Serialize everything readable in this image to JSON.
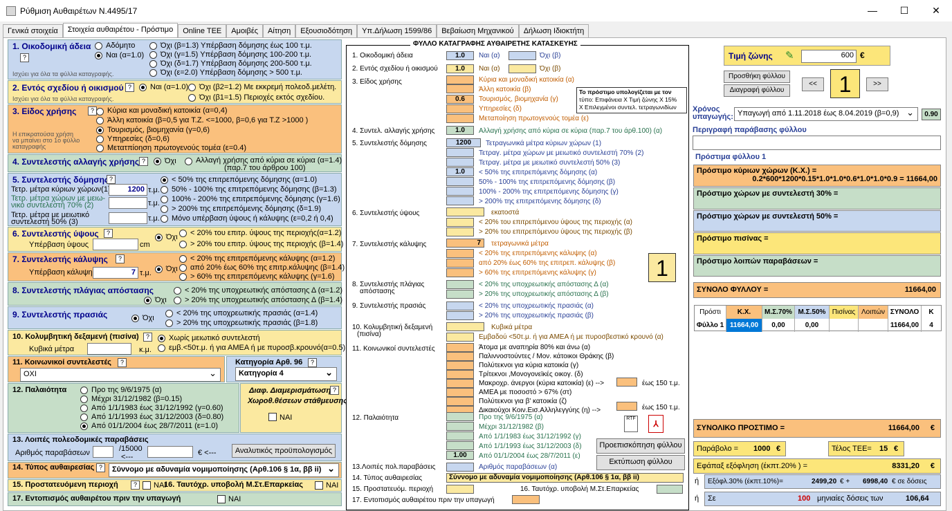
{
  "window": {
    "title": "Ρύθμιση Αυθαιρέτων Ν.4495/17",
    "min": "—",
    "max": "☐",
    "close": "✕"
  },
  "tabs": [
    "Γενικά στοιχεία",
    "Στοιχεία αυθαιρέτου - Πρόστιμο",
    "Online TEE",
    "Αμοιβές",
    "Αίτηση",
    "Εξουσιοδότηση",
    "Υπ.Δήλωση 1599/86",
    "Βεβαίωση Μηχανικού",
    "Δήλωση Ιδιοκτήτη"
  ],
  "left": {
    "s1": {
      "title": "1. Οικοδομική άδεια",
      "o": [
        "Αδόμητο",
        "Ναι (α=1.0)",
        "Όχι (β=1.3) Υπέρβαση δόμησης έως 100 τ.μ.",
        "Όχι (γ=1.5) Υπέρβαση δόμησης 100-200 τ.μ.",
        "Όχι (δ=1.7) Υπέρβαση δόμησης 200-500 τ.μ.",
        "Όχι (ε=2.0) Υπέρβαση δόμησης > 500 τ.μ."
      ],
      "note": "Ισχύει για όλα τα φύλλα καταγραφής."
    },
    "s2": {
      "title": "2. Εντός σχεδίου ή οικισμού",
      "o": [
        "Ναι (α=1.0)",
        "Όχι (β2=1.2) Με εκκρεμή πολεοδ.μελέτη.",
        "Όχι (β1=1.5) Περιοχές εκτός σχεδίου."
      ],
      "note": "Ισχύει για όλα τα φύλλα καταγραφής."
    },
    "s3": {
      "title": "3. Είδος χρήσης",
      "o": [
        "Κύρια και μοναδική κατοικία (α=0,4)",
        "Άλλη κατοικία (β=0,5 για Τ.Ζ. <=1000, β=0,6 για Τ.Ζ >1000 )",
        "Τουρισμός, βιομηχανία (γ=0,6)",
        "Υπηρεσίες (δ=0,6)",
        "Μετατπίοηση πρωτογενούς τομέα (ε=0.4)"
      ],
      "note": "Η επικρατούσα χρήση να μπαίνει στο 1ο φύλλο καταγραφής"
    },
    "s4": {
      "title": "4. Συντελεστής αλλαγής χρήσης",
      "o": [
        "Όχι",
        "Αλλαγή χρήσης από κύρια σε κύρια (α=1.4)",
        "(παρ.7 του άρθρου 100)"
      ]
    },
    "s5": {
      "title": "5. Συντελεστής δόμησης",
      "l1": "Τετρ. μέτρα κύριων χώρων(1)",
      "v1": "1200",
      "l2": "Τετρ. μέτρα χώρων με μειω-",
      "l2b": "νικό συντελεστή 70% (2)",
      "l3": "Τετρ. μέτρα με μειωτικό",
      "l3b": "συντελεστή 50% (3)",
      "u": "τ.μ.",
      "o": [
        "< 50% της επιτρεπόμενης δόμησης (α=1.0)",
        "50% - 100% της επιτρεπόμενης δόμησης (β=1.3)",
        "100% - 200% της επιτρεπόμενης δόμησης (γ=1.6)",
        "> 200% της επιτρεπόμενης δόμησης (δ=1.9)",
        "Μόνο υπέρβαση ύψους ή κάλυψης (ε=0,2 ή 0,4)"
      ]
    },
    "s6": {
      "title": "6. Συντελεστής ύψους",
      "l": "Υπέρβαση ύψους",
      "u": "cm",
      "o": [
        "Όχι",
        "< 20% του επιτρ. ύψους της περιοχής(α=1.2)",
        "> 20% του επιτρ. ύψους της περιοχής (β=1.4)"
      ]
    },
    "s7": {
      "title": "7. Συντελεστής κάλυψης",
      "l": "Υπέρβαση κάλυψης",
      "v": "7",
      "u": "τ.μ.",
      "o": [
        "Όχι",
        "< 20% της επιτρεπόμενης κάλυψης (α=1.2)",
        "από 20% έως 60% της επιτρ.κάλυψης (β=1.4)",
        "> 60% της επιτρεπόμενης κάλυψης (γ=1.6)"
      ]
    },
    "s8": {
      "title": "8. Συντελεστής πλάγιας απόστασης",
      "o": [
        "Όχι",
        "< 20% της υποχρεωτικής απόστασης Δ (α=1.2)",
        "> 20% της υποχρεωτικής απόστασης Δ (β=1.4)"
      ]
    },
    "s9": {
      "title": "9. Συντελεστής πρασιάς",
      "o": [
        "Όχι",
        "< 20% της υποχρεωτικής πρασιάς (α=1.4)",
        "> 20% της υποχρεωτικής πρασιάς (β=1.8)"
      ]
    },
    "s10": {
      "title": "10. Κολυμβητική δεξαμενή (πισίνα)",
      "l": "Κυβικά μέτρα",
      "u": "κ.μ.",
      "o": [
        "Χωρίς μειωτικό συντελεστή",
        "εμβ.<50τ.μ. ή για ΑΜΕΑ ή με πυροσβ.κρουνό(α=0.5)"
      ]
    },
    "s11": {
      "title": "11. Κοινωνικοί συντελεστές",
      "val": "ΟΧΙ",
      "cat": "Κατηγορία Αρθ. 96",
      "catval": "Κατηγορία 4"
    },
    "s12": {
      "title": "12. Παλαιότητα",
      "o": [
        "Προ της 9/6/1975 (α)",
        "Μέχρι 31/12/1982 (β=0.15)",
        "Από 1/1/1983 έως 31/12/1992 (γ=0.60)",
        "Από 1/1/1993 έως 31/12/2003 (δ=0.80)",
        "Από 01/1/2004 έως 28/7/2011 (ε=1.0)"
      ],
      "d1": "Διαφ. Διαμερισμάτωση /",
      "d2": "Χωροθ.θέσεων στάθμευσης",
      "nai": "ΝΑΙ"
    },
    "s13": {
      "title": "13. Λοιπές πολεοδομικές παραβάσεις",
      "l": "Αριθμός παραβάσεων",
      "fr": "/15000",
      "ar": "<---",
      "eu": "€ <---",
      "btn": "Αναλυτικός προϋπολογισμός"
    },
    "s14": {
      "title": "14. Τύπος αυθαιρεσίας",
      "val": "Σύννομο με αδυναμία νομιμοποίησης (Αρθ.106 § 1α, ββ ii)"
    },
    "s15": {
      "title": "15. Προστατευόμενη περιοχή",
      "nai": "ΝΑΙ"
    },
    "s16": {
      "title": "16. Ταυτόχρ. υποβολή Μ.Στ.Επαρκείας",
      "nai": "ΝΑΙ"
    },
    "s17": {
      "title": "17. Εντοπισμός αυθαιρέτου πριν την υπαγωγή",
      "nai": "ΝΑΙ"
    }
  },
  "form": {
    "title": "ΦΥΛΛΟ ΚΑΤΑΓΡΑΦΗΣ ΑΥΘΑΙΡΕΤΗΣ ΚΑΤΑΣΚΕΥΗΣ",
    "sheet": "1",
    "note": [
      "Το πρόστιμο υπολογίζεται με τον",
      "τύπο: Επιφάνεια Χ Τιμή ζώνης Χ 15%",
      "Χ Επιλεγμένοι συντελ. τετραγωνιδίων"
    ],
    "r1": {
      "l": "1. Οικοδομική άδεια",
      "v": "1.0",
      "a": "Ναι (α)",
      "b": "Όχι (β)"
    },
    "r2": {
      "l": "2. Εντός σχεδίου ή οικισμού",
      "v": "1.0",
      "a": "Ναι (α)",
      "b": "Όχι (β)"
    },
    "r3": {
      "l": "3. Είδος χρήσης",
      "v": "0.6",
      "o": [
        "Κύρια και μοναδική κατοικία (α)",
        "Άλλη κατοικία (β)",
        "Τουρισμός, βιομηχανία (γ)",
        "Υπηρεσίες (δ)",
        "Μεταποίηση πρωτογενούς τομέα (ε)"
      ]
    },
    "r4": {
      "l": "4. Συντελ. αλλαγής χρήσης",
      "v": "1.0",
      "t": "Αλλαγή χρήσης από κύρια σε κύρια (παρ.7 του άρθ.100) (α)"
    },
    "r5": {
      "l": "5. Συντελεστής δόμησης",
      "v": "1200",
      "v2": "1.0",
      "o": [
        "Τετραγωνικά μέτρα κύριων χώρων (1)",
        "Τετραγ. μέτρα χώρων με μειωτικό συντελεστή 70% (2)",
        "Τετραγ. μέτρα με μειωτικό συντελεστή 50% (3)",
        "< 50% της επιτρεπόμενης δόμησης (α)",
        "50% - 100% της επιτρεπόμενης δόμησης (β)",
        "100% - 200% της επιτρεπόμενης δόμησης (γ)",
        "> 200% της επιτρεπόμενης δόμησης (δ)"
      ]
    },
    "r6": {
      "l": "6. Συντελεστής ύψους",
      "o": [
        "εκατοστά",
        "< 20% του επιτρεπόμενου ύψους της περιοχής (α)",
        "> 20% του επιτρεπόμενου ύψους της περιοχής (β)"
      ]
    },
    "r7": {
      "l": "7. Συντελεστής κάλυψης",
      "v": "7",
      "o": [
        "τετραγωνικά μέτρα",
        "< 20% της επιτρεπόμενης κάλυψης (α)",
        "από 20% έως 60% της επιτρεπ. κάλυψης (β)",
        "> 60% της επιτρεπόμενης κάλυψης (γ)"
      ]
    },
    "r8": {
      "l": "8. Συντελεστής πλάγιας",
      "l2": "απόστασης",
      "o": [
        "< 20% της υποχρεωτικής απόστασης Δ (α)",
        "> 20% της υποχρεωτικής απόστασης Δ (β)"
      ]
    },
    "r9": {
      "l": "9. Συντελεστής πρασιάς",
      "o": [
        "< 20% της υποχρεωτικής πρασιάς (α)",
        "> 20% της υποχρεωτικής πρασιάς (β)"
      ]
    },
    "r10": {
      "l": "10. Κολυμβητική δεξαμενή",
      "l2": "(πισίνα)",
      "o": [
        "Κυβικά μέτρα",
        "Εμβαδού <50τ.μ. ή για ΑΜΕΑ ή με πυροσβεστικό κρουνό (α)"
      ]
    },
    "r11": {
      "l": "11. Κοινωνικοί συντελεστές",
      "o": [
        "Άτομα με αναπηρία 80% και άνω (α)",
        "Παλιννοστούντες / Μον. κάτοικοι Θράκης (β)",
        "Πολύτεκνοι για κύρια κατοικία (γ)",
        "Τρίτεκνοι ,Μονογονεϊκές οικογ. (δ)",
        "Μακροχρ. άνεργοι (κύρια κατοικία) (ε) -->",
        "ΑΜΕΑ με ποσοστό > 67% (στ)",
        "Πολύτεκνοι για β' κατοικία (ζ)",
        "Δικαιούχοι Κοιν.Εισ.Αλληλεγγύης (η) -->"
      ],
      "u": "έως 150 τ.μ."
    },
    "r12": {
      "l": "12. Παλαιότητα",
      "v": "1.00",
      "o": [
        "Προ της 9/6/1975 (α)",
        "Μέχρι 31/12/1982 (β)",
        "Από 1/1/1983 έως 31/12/1992 (γ)",
        "Από 1/1/1993 έως 31/12/2003 (δ)",
        "Από 01/1/2004 έως 28/7/2011 (ε)"
      ]
    },
    "r13": {
      "l": "13.Λοιπές πολ.παραβάσεις",
      "t": "Αριθμός παραβάσεων (α)"
    },
    "r14": {
      "l": "14. Τύπος αυθαιρεσίας",
      "t": "Σύννομο με αδυναμία νομιμοποίησης (Αρθ.106 § 1α, ββ ii)"
    },
    "r15": {
      "l": "15. Προστατευόμ. περιοχή",
      "t": "16. Ταυτόχρ. υποβολή Μ.Στ.Επαρκείας"
    },
    "r17": {
      "l": "17. Εντοπισμός αυθαιρέτου πριν την υπαγωγή"
    },
    "preview": "Προεπισκόπηση φύλλου",
    "print": "Εκτύπωση φύλλου"
  },
  "right": {
    "zone_l": "Τιμή ζώνης",
    "zone_v": "600",
    "eur": "€",
    "add": "Προσθήκη φύλλου",
    "del": "Διαγραφή φύλλου",
    "prev": "<<",
    "next": ">>",
    "sheet": "1",
    "time_l": "Χρόνος",
    "time_l2": "υπαγωγής:",
    "time_v": "Υπαγωγή από 1.11.2018 έως 8.04.2019 (β=0,9)",
    "time_c": "0.90",
    "desc": "Περιγραφή παράβασης φύλλου",
    "fines": "Πρόστιμα φύλλου 1",
    "f1": "Πρόστιμο κύριων χώρων (Κ.Χ.) =",
    "f1v": "0.2*600*1200*0.15*1.0*1.0*0.6*1.0*1.0*0.9 = 11664,00",
    "f2": "Πρόστιμο χώρων με συντελεστή 30% =",
    "f3": "Πρόστιμο χώρων με συντελεστή 50% =",
    "f4": "Πρόστιμο πισίνας =",
    "f5": "Πρόστιμο λοιπών παραβάσεων =",
    "sum_l": "ΣΥΝΟΛΟ ΦΥΛΛΟΥ =",
    "sum_v": "11664,00",
    "grid_h": [
      "Πρόστι",
      "Κ.Χ.",
      "Μ.Σ.70%",
      "Μ.Σ.50%",
      "Πισίνας",
      "Λοιπών",
      "ΣΥΝΟΛΟ",
      "Κ"
    ],
    "grid_r": [
      "Φύλλο 1",
      "11664,00",
      "0,00",
      "0,00",
      "",
      "",
      "11664,00",
      "4"
    ],
    "total_l": "ΣΥΝΟΛΙΚΟ ΠΡΟΣΤΙΜΟ =",
    "total_v": "11664,00",
    "par_l": "Παράβολο =",
    "par_v": "1000",
    "tee_l": "Τέλος ΤΕΕ=",
    "tee_v": "15",
    "once_l": "Εφάπαξ εξόφληση (έκπτ.20% ) =",
    "once_v": "8331,20",
    "or": "ή",
    "p30_l": "Εξόφλ.30% (έκπτ.10%)=",
    "p30_v": "2499,20",
    "plus": "€ +",
    "p30_r": "6998,40",
    "p30_s": "€ σε δόσεις",
    "in_l": "Σε",
    "in_n": "100",
    "in_t": "μηνιαίες δόσεις των",
    "in_v": "106,64"
  }
}
